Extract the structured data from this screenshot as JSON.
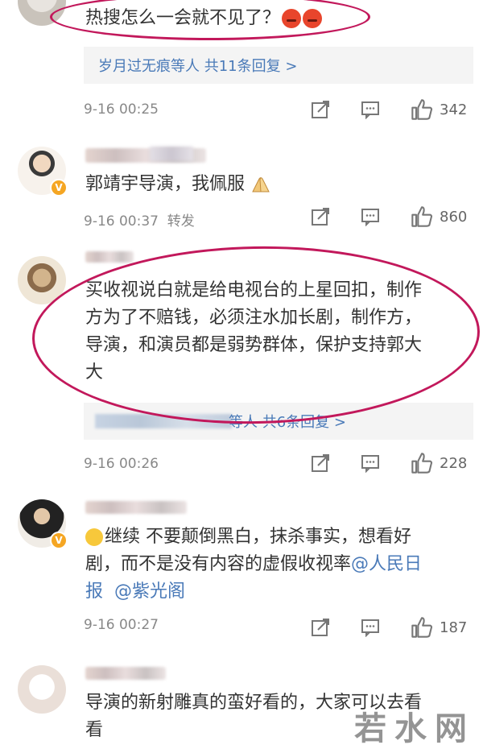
{
  "comments": [
    {
      "text": "热搜怎么一会就不见了？",
      "reply_summary": "岁月过无痕等人  共11条回复 >",
      "time": "9-16 00:25",
      "extra": "",
      "likes": "342"
    },
    {
      "text": "郭靖宇导演，我佩服",
      "time": "9-16 00:37",
      "extra": "转发",
      "likes": "860"
    },
    {
      "text_line1": "买收视说白就是给电视台的上星回扣，制作",
      "text_line2": "方为了不赔钱，必须注水加长剧，制作方，",
      "text_line3": "导演，和演员都是弱势群体，保护支持郭大",
      "text_line4": "大",
      "reply_summary": "等人  共6条回复 >",
      "time": "9-16 00:26",
      "likes": "228"
    },
    {
      "text_line1_a": "继续  不要颠倒黑白，抹杀事实，想看好",
      "text_line2_a": "剧，而不是没有内容的虚假收视率",
      "mention1": "@人民日",
      "mention1_cont": "报",
      "mention2": "@紫光阁",
      "time": "9-16 00:27",
      "likes": "187"
    },
    {
      "text_line1": "导演的新射雕真的蛮好看的，大家可以去看",
      "text_line2": "看"
    }
  ],
  "watermark": "若水网",
  "colors": {
    "accent_link": "#4a7ab8",
    "highlight_oval": "#c2185b",
    "vip_badge": "#f5a623"
  },
  "icons": [
    "share-icon",
    "comment-icon",
    "like-icon",
    "verified-badge-icon",
    "angry-emoji",
    "praying-hands-emoji",
    "tearful-face-emoji"
  ]
}
